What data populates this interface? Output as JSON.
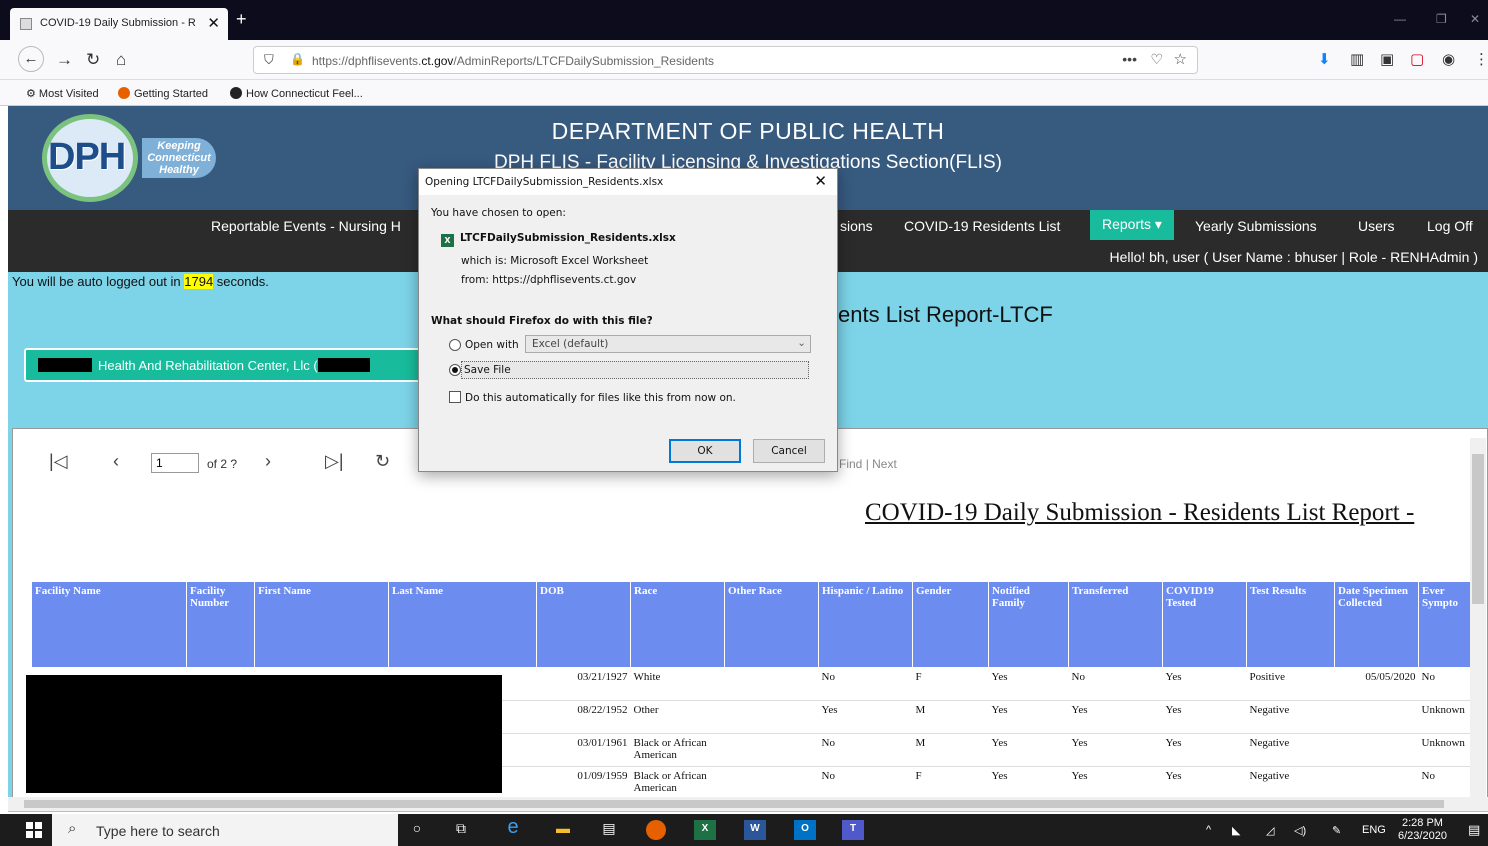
{
  "browser": {
    "tab_title": "COVID-19 Daily Submission - R",
    "url_prefix": "https://dphflisevents.",
    "url_domain": "ct.gov",
    "url_path": "/AdminReports/LTCFDailySubmission_Residents",
    "bookmarks": [
      "Most Visited",
      "Getting Started",
      "How Connecticut Feel..."
    ]
  },
  "header": {
    "logo_text": "DPH",
    "logo_tagline": [
      "Keeping",
      "Connecticut",
      "Healthy"
    ],
    "title": "DEPARTMENT OF PUBLIC HEALTH",
    "subtitle": "DPH FLIS - Facility Licensing & Investigations Section(FLIS)"
  },
  "menu": {
    "items": [
      "Reportable Events - Nursing H",
      "sions",
      "COVID-19 Residents List",
      "Reports ▾",
      "Yearly Submissions",
      "Users",
      "Log Off"
    ],
    "active_index": 3,
    "greeting": "Hello! bh, user ( User Name : bhuser | Role - RENHAdmin )"
  },
  "main": {
    "autologout_pre": "You will be auto logged out in ",
    "autologout_seconds": "1794",
    "autologout_post": " seconds.",
    "report_title": "ents List Report-LTCF",
    "facility_name": "Health And Rehabilitation Center, Llc ("
  },
  "viewer": {
    "page_input": "1",
    "page_of": "of 2 ?",
    "find_label": "Find",
    "next_label": "| Next",
    "heading": "COVID-19 Daily Submission - Residents List Report -",
    "columns": [
      "Facility Name",
      "Facility Number",
      "First Name",
      "Last Name",
      "DOB",
      "Race",
      "Other Race",
      "Hispanic / Latino",
      "Gender",
      "Notified Family",
      "Transferred",
      "COVID19 Tested",
      "Test Results",
      "Date Specimen Collected",
      "Ever Sympto"
    ],
    "rows": [
      [
        "",
        "",
        "",
        "",
        "03/21/1927",
        "White",
        "",
        "No",
        "F",
        "Yes",
        "No",
        "Yes",
        "Positive",
        "05/05/2020",
        "No"
      ],
      [
        "",
        "",
        "",
        "",
        "08/22/1952",
        "Other",
        "",
        "Yes",
        "M",
        "Yes",
        "Yes",
        "Yes",
        "Negative",
        "",
        "Unknown"
      ],
      [
        "",
        "",
        "",
        "",
        "03/01/1961",
        "Black or African American",
        "",
        "No",
        "M",
        "Yes",
        "Yes",
        "Yes",
        "Negative",
        "",
        "Unknown"
      ],
      [
        "",
        "",
        "",
        "",
        "01/09/1959",
        "Black or African American",
        "",
        "No",
        "F",
        "Yes",
        "Yes",
        "Yes",
        "Negative",
        "",
        "No"
      ]
    ]
  },
  "dialog": {
    "title": "Opening LTCFDailySubmission_Residents.xlsx",
    "chosen_label": "You have chosen to open:",
    "file_name": "LTCFDailySubmission_Residents.xlsx",
    "which_is": "which is: Microsoft Excel Worksheet",
    "from": "from: https://dphflisevents.ct.gov",
    "question": "What should Firefox do with this file?",
    "open_with_label": "Open with",
    "open_with_value": "Excel (default)",
    "save_file_label": "Save File",
    "auto_label": "Do this automatically for files like this from now on.",
    "ok_label": "OK",
    "cancel_label": "Cancel",
    "selected_option": "save"
  },
  "taskbar": {
    "search_placeholder": "Type here to search",
    "lang": "ENG",
    "time": "2:28 PM",
    "date": "6/23/2020"
  }
}
